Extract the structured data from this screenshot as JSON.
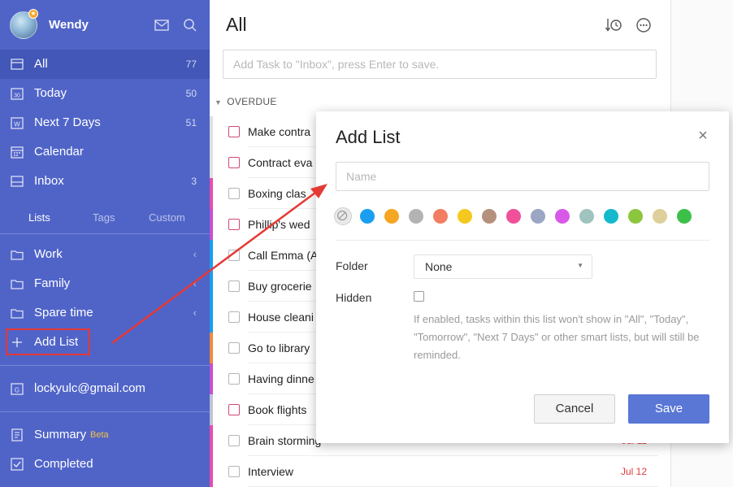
{
  "sidebar": {
    "username": "Wendy",
    "nav": [
      {
        "label": "All",
        "count": "77",
        "icon": "list-icon"
      },
      {
        "label": "Today",
        "count": "50",
        "icon": "calendar-30-icon"
      },
      {
        "label": "Next 7 Days",
        "count": "51",
        "icon": "calendar-week-icon"
      },
      {
        "label": "Calendar",
        "count": "",
        "icon": "calendar-grid-icon"
      },
      {
        "label": "Inbox",
        "count": "3",
        "icon": "inbox-icon"
      }
    ],
    "tabs": [
      "Lists",
      "Tags",
      "Custom"
    ],
    "lists": [
      {
        "label": "Work",
        "icon": "folder-icon"
      },
      {
        "label": "Family",
        "icon": "folder-icon"
      },
      {
        "label": "Spare time",
        "icon": "folder-icon"
      }
    ],
    "add_list": "Add List",
    "account": "lockyulc@gmail.com",
    "summary": "Summary",
    "beta": "Beta",
    "completed": "Completed"
  },
  "main": {
    "title": "All",
    "add_task_placeholder": "Add Task to \"Inbox\", press Enter to save.",
    "section": "OVERDUE",
    "tasks": [
      {
        "title": "Make contra",
        "stripe": "#e0e0e0",
        "cb": "#d0487a",
        "date": ""
      },
      {
        "title": "Contract eva",
        "stripe": "#e0e0e0",
        "cb": "#d0487a",
        "date": ""
      },
      {
        "title": "Boxing clas",
        "stripe": "#e94bb0",
        "cb": "#b5b5b5",
        "date": ""
      },
      {
        "title": "Phillip's wed",
        "stripe": "#c64fd6",
        "cb": "#d0487a",
        "date": ""
      },
      {
        "title": "Call Emma (A",
        "stripe": "#1a9ef0",
        "cb": "#b5b5b5",
        "date": ""
      },
      {
        "title": "Buy grocerie",
        "stripe": "#1a9ef0",
        "cb": "#b5b5b5",
        "date": ""
      },
      {
        "title": "House cleani",
        "stripe": "#1a9ef0",
        "cb": "#b5b5b5",
        "date": ""
      },
      {
        "title": "Go to library",
        "stripe": "#f08a3c",
        "cb": "#b5b5b5",
        "date": ""
      },
      {
        "title": "Having dinne",
        "stripe": "#c64fd6",
        "cb": "#b5b5b5",
        "date": ""
      },
      {
        "title": "Book flights",
        "stripe": "#c0c4d4",
        "cb": "#d0487a",
        "date": ""
      },
      {
        "title": "Brain storming",
        "stripe": "#e94bb0",
        "cb": "#b5b5b5",
        "date": "Jul 11"
      },
      {
        "title": "Interview",
        "stripe": "#e94bb0",
        "cb": "#b5b5b5",
        "date": "Jul 12"
      }
    ]
  },
  "dialog": {
    "title": "Add List",
    "name_placeholder": "Name",
    "colors": [
      "none",
      "#1a9ef0",
      "#f5a623",
      "#b3b3b3",
      "#f27d62",
      "#f5c81e",
      "#b5917d",
      "#f0509a",
      "#9aa6c4",
      "#d859e8",
      "#9fc3bf",
      "#14b9cc",
      "#8cc63f",
      "#ddd09a",
      "#3cc04a"
    ],
    "folder_label": "Folder",
    "folder_value": "None",
    "hidden_label": "Hidden",
    "help_text": "If enabled, tasks within this list won't show in \"All\", \"Today\", \"Tomorrow\", \"Next 7 Days\" or other smart lists, but will still be reminded.",
    "cancel": "Cancel",
    "save": "Save"
  }
}
